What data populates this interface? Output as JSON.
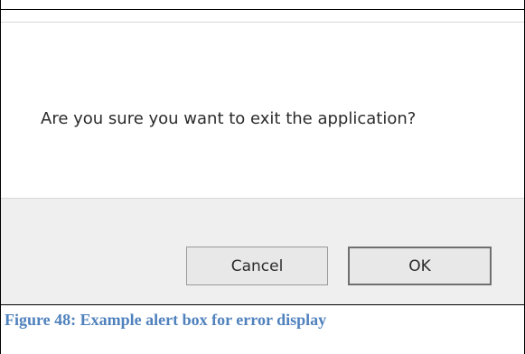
{
  "dialog": {
    "message": "Are you sure you want to exit the application?",
    "buttons": {
      "cancel_label": "Cancel",
      "ok_label": "OK"
    }
  },
  "caption": {
    "text": "Figure 48: Example alert box for error display"
  },
  "colors": {
    "caption_text": "#4f81bd",
    "footer_background": "#efefef",
    "button_background": "#e8e8e8"
  }
}
